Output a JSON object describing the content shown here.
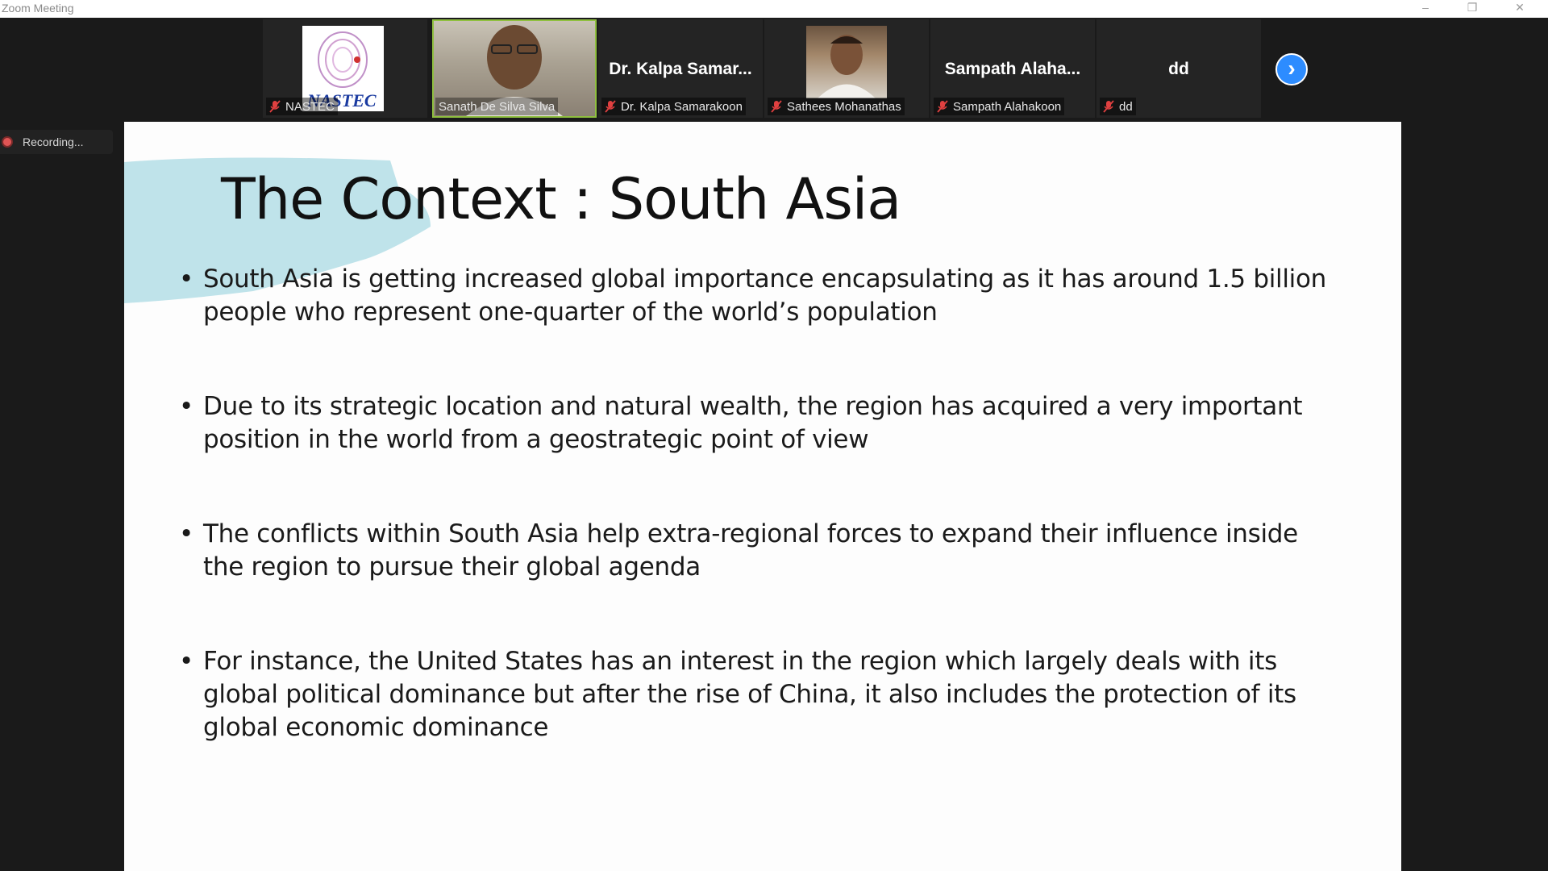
{
  "window": {
    "title": "Zoom Meeting",
    "controls": {
      "minimize": "–",
      "maximize": "❐",
      "close": "✕"
    }
  },
  "participants": [
    {
      "display": "logo",
      "logo_text": "NASTEC",
      "label": "NASTEC",
      "muted": true,
      "active": false
    },
    {
      "display": "video",
      "label": "Sanath De Silva Silva",
      "muted": false,
      "active": true
    },
    {
      "display": "name",
      "big_name": "Dr. Kalpa Samar...",
      "label": "Dr. Kalpa Samarakoon",
      "muted": true,
      "active": false
    },
    {
      "display": "video",
      "label": "Sathees Mohanathas",
      "muted": true,
      "active": false
    },
    {
      "display": "name",
      "big_name": "Sampath  Alaha...",
      "label": "Sampath Alahakoon",
      "muted": true,
      "active": false
    },
    {
      "display": "name",
      "big_name": "dd",
      "label": "dd",
      "muted": true,
      "active": false
    }
  ],
  "next_page_icon": "chevron-right-icon",
  "recording": {
    "label": "Recording..."
  },
  "slide": {
    "title": "The Context : South Asia",
    "bullets": [
      "South Asia is getting increased global importance encapsulating as it has around 1.5 billion people who represent one-quarter of the world’s population",
      "Due to its strategic location and natural wealth, the region has acquired a very important position in the world from a geostrategic point of view",
      "The conflicts within South Asia help extra-regional forces to expand their influence inside the region to pursue their global agenda",
      " For instance, the United States has an interest in the region which largely deals with its global political dominance but after the rise of China, it also includes the protection of its global economic dominance"
    ]
  },
  "colors": {
    "accent": "#2d8cff",
    "active_speaker": "#8fbf3f",
    "muted_mic": "#e04040",
    "brush": "#bfe3ea"
  }
}
